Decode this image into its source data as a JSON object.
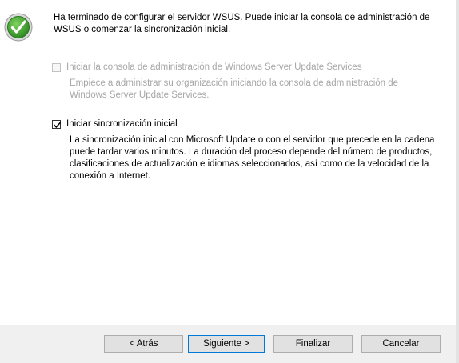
{
  "intro": {
    "text": "Ha terminado de configurar el servidor WSUS. Puede iniciar la consola de administración de WSUS o comenzar la sincronización inicial."
  },
  "options": [
    {
      "label": "Iniciar la consola de administración de Windows Server Update Services",
      "checked": false,
      "enabled": false,
      "description": "Empiece a administrar su organización iniciando la consola de administración de Windows Server Update Services."
    },
    {
      "label": "Iniciar sincronización inicial",
      "checked": true,
      "enabled": true,
      "description": "La sincronización inicial con Microsoft Update o con el servidor que precede en la cadena puede tardar varios minutos. La duración del proceso depende del número de productos, clasificaciones de actualización e idiomas seleccionados, así como de la velocidad de la conexión a Internet."
    }
  ],
  "buttons": {
    "back": "< Atrás",
    "next": "Siguiente >",
    "finish": "Finalizar",
    "cancel": "Cancelar"
  },
  "icons": {
    "success": "checkmark-circle-icon"
  },
  "colors": {
    "success_green": "#3a9a2a",
    "focus_border": "#0078d7"
  }
}
